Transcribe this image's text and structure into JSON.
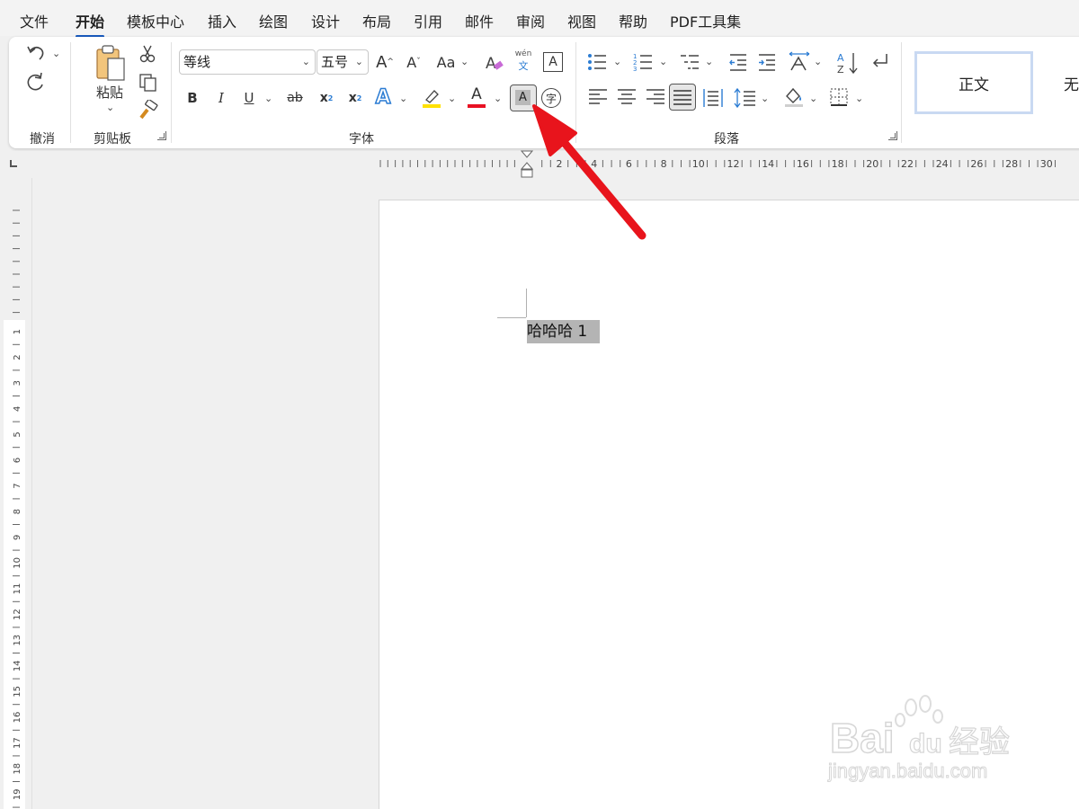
{
  "menu": {
    "tabs": [
      "文件",
      "开始",
      "模板中心",
      "插入",
      "绘图",
      "设计",
      "布局",
      "引用",
      "邮件",
      "审阅",
      "视图",
      "帮助",
      "PDF工具集"
    ],
    "active_index": 1
  },
  "ribbon": {
    "groups": {
      "undo": "撤消",
      "clipboard": "剪贴板",
      "font": "字体",
      "paragraph": "段落"
    },
    "clipboard": {
      "paste_label": "粘贴"
    },
    "font": {
      "font_name": "等线",
      "font_size": "五号",
      "grow_font": "A",
      "shrink_font": "A",
      "change_case": "Aa",
      "pinyin_top": "wén",
      "pinyin_bottom": "文",
      "char_border": "A",
      "bold": "B",
      "italic": "I",
      "underline": "U",
      "strikethrough": "ab",
      "subscript": "x",
      "superscript": "x",
      "text_effects": "A",
      "font_color": "A",
      "char_shading": "A",
      "enclose_char": "字",
      "highlight_color": "#ffe100",
      "font_color_value": "#e81123"
    },
    "styles": {
      "items": [
        "正文",
        "无"
      ]
    }
  },
  "document": {
    "text": "哈哈哈 1"
  },
  "rulers": {
    "horizontal_labels": [
      "2",
      "4",
      "6",
      "8",
      "10",
      "12",
      "14",
      "16",
      "18",
      "20",
      "22",
      "24",
      "26",
      "28",
      "30"
    ],
    "vertical_labels": [
      "1",
      "2",
      "3",
      "4",
      "5",
      "6",
      "7",
      "8",
      "9",
      "10",
      "11",
      "12",
      "13",
      "14",
      "15",
      "16",
      "17",
      "18",
      "19"
    ]
  },
  "watermark": {
    "brand": "Bai",
    "brand_du": "du",
    "brand_cn": "经验",
    "url": "jingyan.baidu.com"
  },
  "colors": {
    "accent": "#185abd",
    "arrow": "#e8141c"
  }
}
